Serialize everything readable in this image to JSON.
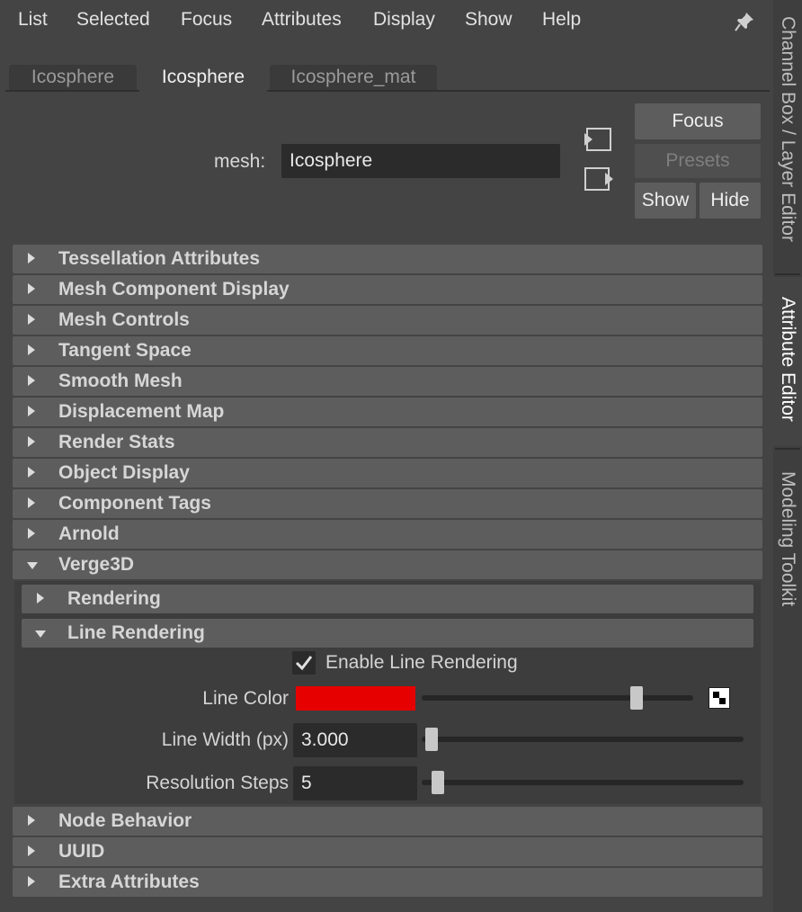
{
  "menu": [
    "List",
    "Selected",
    "Focus",
    "Attributes",
    "Display",
    "Show",
    "Help"
  ],
  "tabs": [
    "Icosphere",
    "Icosphere",
    "Icosphere_mat"
  ],
  "active_tab_index": 1,
  "mesh": {
    "label": "mesh:",
    "value": "Icosphere"
  },
  "buttons": {
    "focus": "Focus",
    "presets": "Presets",
    "show": "Show",
    "hide": "Hide"
  },
  "sections": [
    "Tessellation Attributes",
    "Mesh Component Display",
    "Mesh Controls",
    "Tangent Space",
    "Smooth Mesh",
    "Displacement Map",
    "Render Stats",
    "Object Display",
    "Component Tags",
    "Arnold",
    "Verge3D"
  ],
  "verge3d": {
    "subsections": [
      "Rendering",
      "Line Rendering"
    ],
    "enable_line_rendering": {
      "label": "Enable Line Rendering",
      "checked": true
    },
    "line_color": {
      "label": "Line Color",
      "color": "#e60000",
      "slider": 0.79
    },
    "line_width": {
      "label": "Line Width (px)",
      "value": "3.000",
      "slider": 0.03
    },
    "resolution_steps": {
      "label": "Resolution Steps",
      "value": "5",
      "slider": 0.05
    }
  },
  "bottom_sections": [
    "Node Behavior",
    "UUID",
    "Extra Attributes"
  ],
  "dock_tabs": [
    "Channel Box / Layer Editor",
    "Attribute Editor",
    "Modeling Toolkit"
  ],
  "active_dock_tab": "Attribute Editor",
  "icons": [
    "pin-icon",
    "select-input-icon",
    "select-output-icon",
    "checkmark-icon",
    "color-picker-icon",
    "expand-arrow-icon",
    "collapse-arrow-icon"
  ],
  "colors": {
    "background": "#444444",
    "frame": "#5d5d5d",
    "field": "#2b2b2b",
    "line_color": "#e60000"
  }
}
